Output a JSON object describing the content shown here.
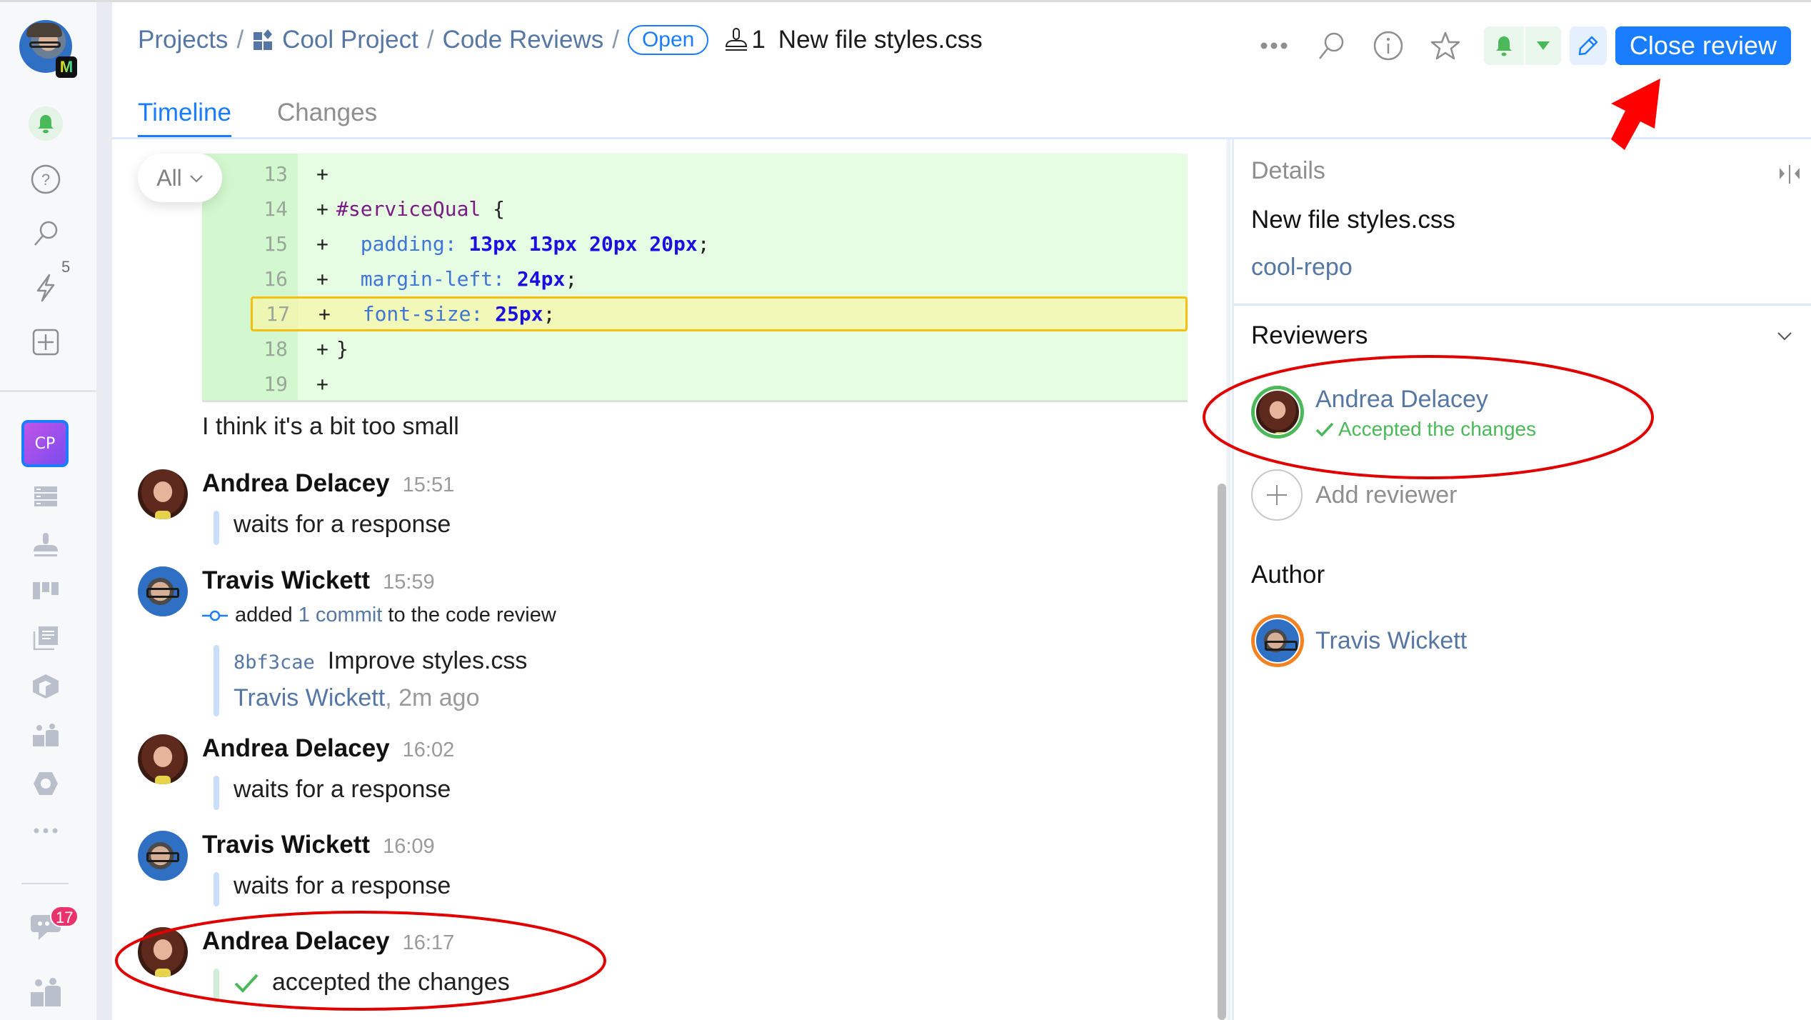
{
  "sidebar": {
    "user_badge": "M",
    "lightning_count": "5",
    "project_tile": "CP",
    "chat_badge_count": "17"
  },
  "header": {
    "breadcrumb": [
      {
        "label": "Projects"
      },
      {
        "label": "Cool Project"
      },
      {
        "label": "Code Reviews"
      }
    ],
    "status_badge": "Open",
    "review_number": "1",
    "review_title": "New file styles.css",
    "toolbar": {
      "more_icon": "more-horizontal-icon",
      "search_icon": "search-icon",
      "info_icon": "info-icon",
      "star_icon": "star-icon",
      "bell_icon": "bell-icon",
      "dropdown_icon": "caret-down-icon",
      "edit_icon": "pencil-icon",
      "close_review_label": "Close review"
    },
    "tabs": [
      {
        "label": "Timeline",
        "active": true
      },
      {
        "label": "Changes",
        "active": false
      }
    ]
  },
  "timeline": {
    "filter_label": "All",
    "code_diff": [
      {
        "line": "13",
        "sign": "+",
        "tokens": []
      },
      {
        "line": "14",
        "sign": "+",
        "tokens": [
          {
            "t": "#serviceQual",
            "c": "sel"
          },
          {
            "t": " {",
            "c": ""
          }
        ]
      },
      {
        "line": "15",
        "sign": "+",
        "tokens": [
          {
            "t": "  padding: ",
            "c": "prop"
          },
          {
            "t": "13px 13px 20px 20px",
            "c": "num"
          },
          {
            "t": ";",
            "c": ""
          }
        ]
      },
      {
        "line": "16",
        "sign": "+",
        "tokens": [
          {
            "t": "  margin-left: ",
            "c": "prop"
          },
          {
            "t": "24px",
            "c": "num"
          },
          {
            "t": ";",
            "c": ""
          }
        ]
      },
      {
        "line": "17",
        "sign": "+",
        "highlighted": true,
        "tokens": [
          {
            "t": "  font-size: ",
            "c": "prop"
          },
          {
            "t": "25px",
            "c": "num"
          },
          {
            "t": ";",
            "c": ""
          }
        ]
      },
      {
        "line": "18",
        "sign": "+",
        "tokens": [
          {
            "t": "}",
            "c": ""
          }
        ]
      },
      {
        "line": "19",
        "sign": "+",
        "tokens": []
      }
    ],
    "comment": "I think it's a bit too small",
    "events": [
      {
        "author": "Andrea Delacey",
        "time": "15:51",
        "text": "waits for a response"
      },
      {
        "author": "Travis Wickett",
        "time": "15:59",
        "action_prefix": "added",
        "action_link": "1 commit",
        "action_suffix": "to the code review",
        "commit": {
          "hash": "8bf3cae",
          "message": "Improve styles.css",
          "author": "Travis Wickett",
          "when": "2m ago"
        }
      },
      {
        "author": "Andrea Delacey",
        "time": "16:02",
        "text": "waits for a response"
      },
      {
        "author": "Travis Wickett",
        "time": "16:09",
        "text": "waits for a response"
      },
      {
        "author": "Andrea Delacey",
        "time": "16:17",
        "text": "accepted the changes"
      }
    ]
  },
  "details": {
    "title": "Details",
    "file": "New file styles.css",
    "repo": "cool-repo",
    "reviewers_title": "Reviewers",
    "reviewer": {
      "name": "Andrea Delacey",
      "status": "Accepted the changes"
    },
    "add_reviewer_label": "Add reviewer",
    "author_title": "Author",
    "author": {
      "name": "Travis Wickett"
    }
  },
  "colors": {
    "accent": "#1a7dff",
    "link": "#5677a3",
    "accepted_green": "#4bb85a",
    "author_ring": "#f58220",
    "diff_added_bg": "#e6fde4",
    "highlight_border": "#f5bf12",
    "annotation_red": "#e00000"
  }
}
